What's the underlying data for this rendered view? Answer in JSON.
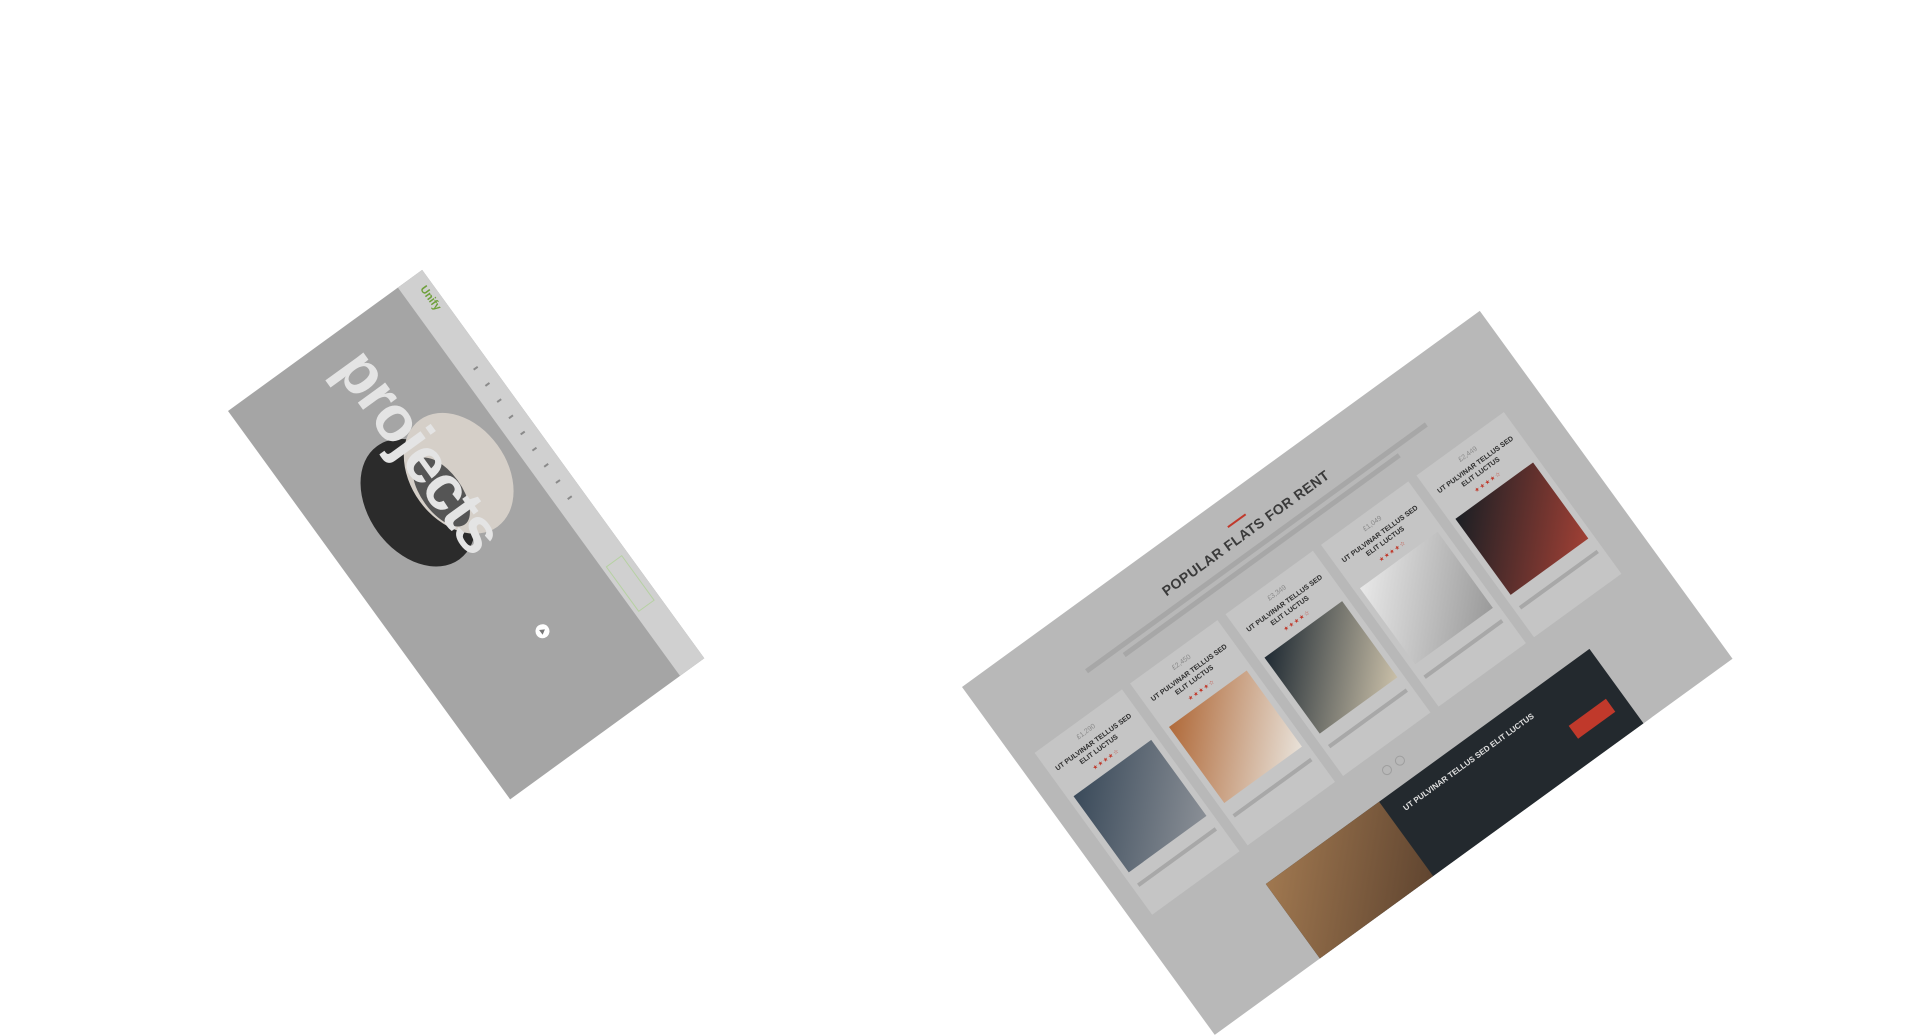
{
  "left_card": {
    "logo": "Unify",
    "title": "projects",
    "nav_items": [
      "",
      "",
      "",
      "",
      "",
      "",
      "",
      "",
      ""
    ]
  },
  "right_card": {
    "section_title": "POPULAR FLATS FOR RENT",
    "listings": [
      {
        "price": "£1,290",
        "name": "UT PULVINAR TELLUS SED ELIT LUCTUS",
        "stars": "★★★★☆"
      },
      {
        "price": "£2,450",
        "name": "UT PULVINAR TELLUS SED ELIT LUCTUS",
        "stars": "★★★★☆"
      },
      {
        "price": "£3,349",
        "name": "UT PULVINAR TELLUS SED ELIT LUCTUS",
        "stars": "★★★★☆"
      },
      {
        "price": "£1,049",
        "name": "UT PULVINAR TELLUS SED ELIT LUCTUS",
        "stars": "★★★★☆"
      },
      {
        "price": "£2,449",
        "name": "UT PULVINAR TELLUS SED ELIT LUCTUS",
        "stars": "★★★★☆"
      }
    ],
    "promo_title": "UT PULVINAR TELLUS SED ELIT LUCTUS"
  }
}
